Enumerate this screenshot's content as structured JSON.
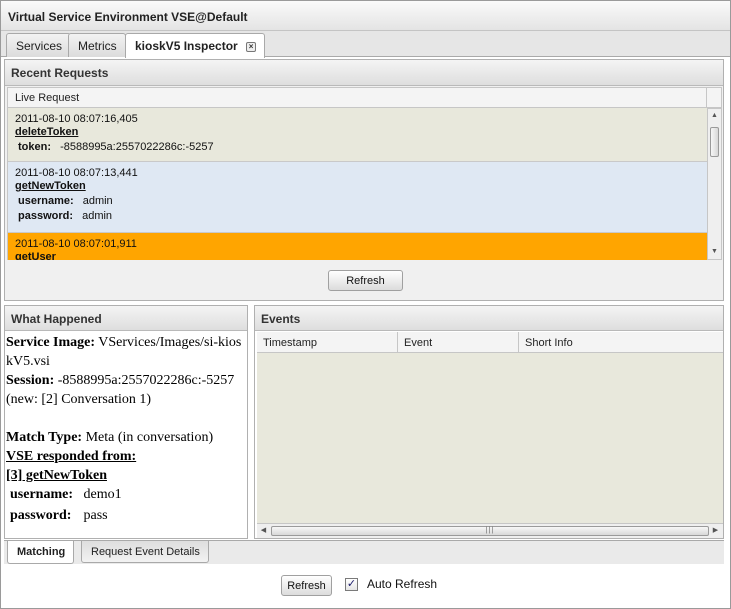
{
  "window": {
    "title": "Virtual Service Environment VSE@Default"
  },
  "tabs": [
    {
      "label": "Services"
    },
    {
      "label": "Metrics"
    },
    {
      "label": "kioskV5 Inspector"
    }
  ],
  "recent_requests": {
    "title": "Recent Requests",
    "column": "Live Request",
    "items": [
      {
        "timestamp": "2011-08-10 08:07:16,405",
        "operation": "deleteToken",
        "args": [
          {
            "key": "token:",
            "value": "-8588995a:2557022286c:-5257"
          }
        ]
      },
      {
        "timestamp": "2011-08-10 08:07:13,441",
        "operation": "getNewToken",
        "args": [
          {
            "key": "username:",
            "value": "admin"
          },
          {
            "key": "password:",
            "value": "admin"
          }
        ]
      },
      {
        "timestamp": "2011-08-10 08:07:01,911",
        "operation": "getUser",
        "args": []
      }
    ],
    "refresh_label": "Refresh"
  },
  "what_happened": {
    "title": "What Happened",
    "service_image_label": "Service Image:",
    "service_image_value": "VServices/Images/si-kioskV5.vsi",
    "session_label": "Session:",
    "session_value": "-8588995a:2557022286c:-5257 (new: [2] Conversation 1)",
    "match_type_label": "Match Type:",
    "match_type_value": "Meta (in conversation)",
    "responded_from": "VSE responded from:",
    "responded_op": "[3] getNewToken",
    "params": [
      {
        "key": "username:",
        "value": "demo1"
      },
      {
        "key": "password:",
        "value": "pass"
      }
    ]
  },
  "events": {
    "title": "Events",
    "columns": [
      "Timestamp",
      "Event",
      "Short Info"
    ]
  },
  "bottom_tabs": [
    {
      "label": "Matching"
    },
    {
      "label": "Request Event Details"
    }
  ],
  "footer": {
    "refresh_label": "Refresh",
    "auto_refresh_label": "Auto Refresh",
    "auto_refresh_checked": true
  },
  "colors": {
    "selected_row": "#ffa500",
    "row_beige": "#e8e8dc",
    "row_blue": "#dfe8f3"
  },
  "icons": {
    "tab_close": "close-icon",
    "scroll_up": "arrow-up-icon",
    "scroll_down": "arrow-down-icon",
    "scroll_left": "arrow-left-icon",
    "scroll_right": "arrow-right-icon",
    "checkbox": "check-icon"
  }
}
